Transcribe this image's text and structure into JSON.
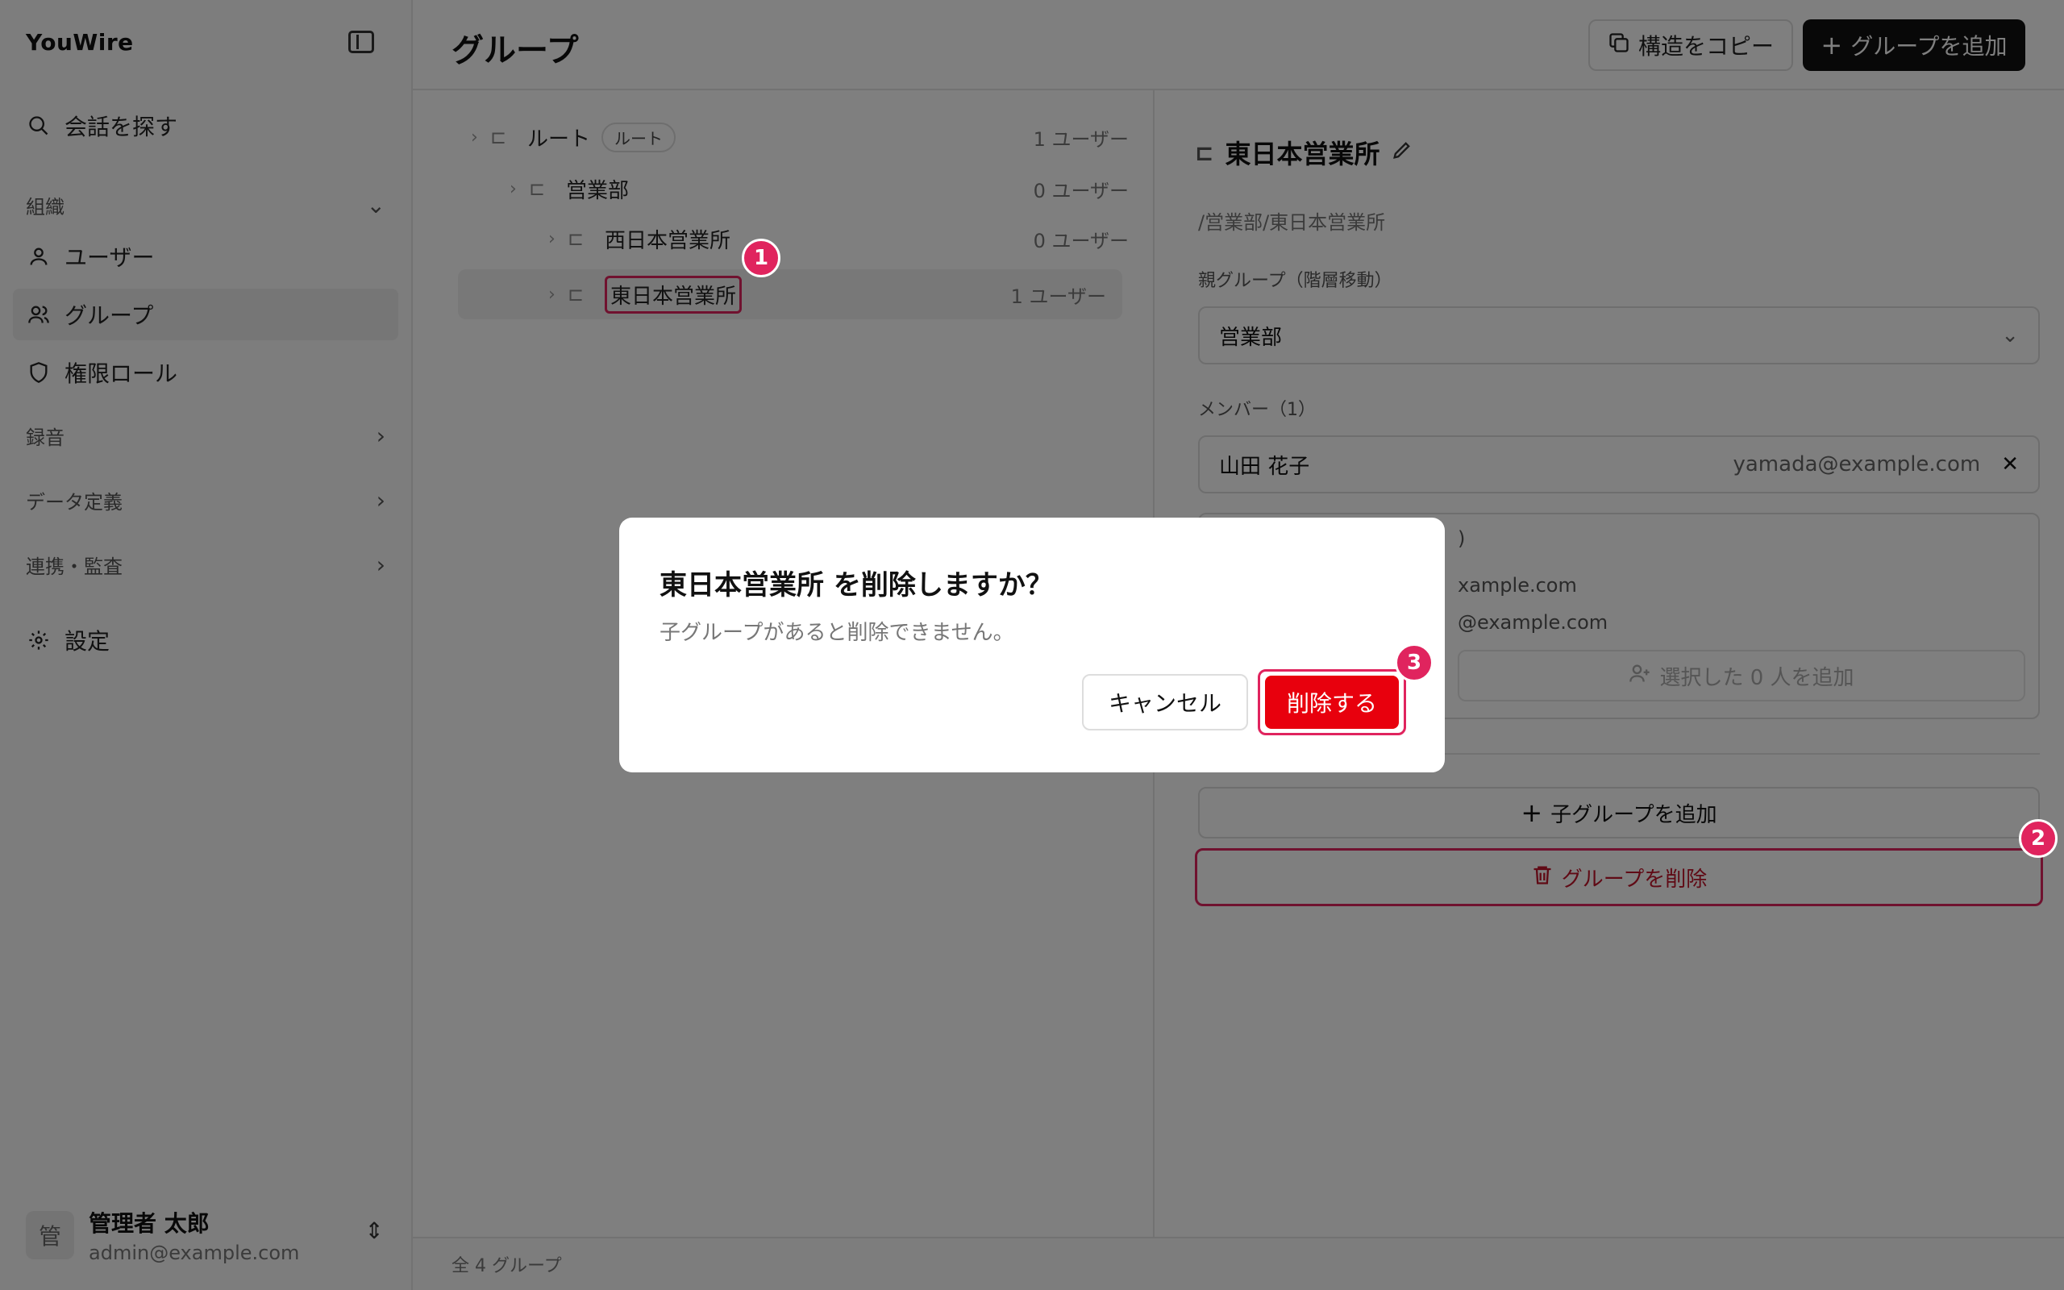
{
  "app": {
    "brand": "YouWire"
  },
  "sidebar": {
    "search": "会話を探す",
    "org_section": "組織",
    "items": [
      "ユーザー",
      "グループ",
      "権限ロール"
    ],
    "recording": "録音",
    "data_def": "データ定義",
    "integration": "連携・監査",
    "settings": "設定",
    "user": {
      "avatar": "管",
      "name": "管理者 太郎",
      "email": "admin@example.com"
    }
  },
  "header": {
    "title": "グループ",
    "copy_label": "構造をコピー",
    "add_label": "グループを追加"
  },
  "tree": {
    "rows": [
      {
        "name": "ルート",
        "badge": "ルート",
        "count": "1 ユーザー"
      },
      {
        "name": "営業部",
        "count": "0 ユーザー"
      },
      {
        "name": "西日本営業所",
        "count": "0 ユーザー"
      },
      {
        "name": "東日本営業所",
        "count": "1 ユーザー"
      }
    ]
  },
  "detail": {
    "title": "東日本営業所",
    "path": "/営業部/東日本営業所",
    "parent_label": "親グループ（階層移動）",
    "parent_value": "営業部",
    "members_label": "メンバー（1）",
    "member": {
      "name": "山田 花子",
      "email": "yamada@example.com"
    },
    "candidate_header": ")",
    "candidate_1": "xample.com",
    "candidate_2": "@example.com",
    "add_selected": "選択した 0 人を追加",
    "add_child": "子グループを追加",
    "delete_group": "グループを削除"
  },
  "footer": {
    "total": "全 4 グループ"
  },
  "dialog": {
    "title": "東日本営業所 を削除しますか？",
    "message": "子グループがあると削除できません。",
    "cancel": "キャンセル",
    "confirm": "削除する"
  },
  "annotations": [
    "1",
    "2",
    "3"
  ],
  "colors": {
    "accent_red": "#e0245e",
    "danger": "#e8000d",
    "primary": "#111111"
  }
}
